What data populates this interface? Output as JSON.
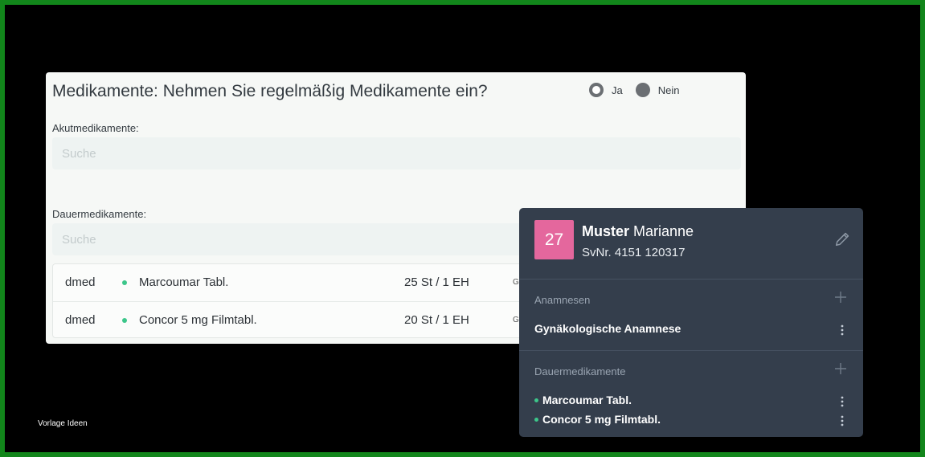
{
  "form": {
    "title": "Medikamente: Nehmen Sie regelmäßig Medikamente ein?",
    "radio": {
      "yes_label": "Ja",
      "no_label": "Nein",
      "selected": "Ja"
    },
    "akut": {
      "label": "Akutmedikamente:",
      "placeholder": "Suche",
      "value": ""
    },
    "dauer": {
      "label": "Dauermedikamente:",
      "placeholder": "Suche",
      "value": ""
    },
    "medications": [
      {
        "source": "dmed",
        "name": "Marcoumar Tabl.",
        "quantity": "25 St / 1 EH",
        "extra": "G"
      },
      {
        "source": "dmed",
        "name": "Concor 5 mg Filmtabl.",
        "quantity": "20 St / 1 EH",
        "extra": "G"
      }
    ]
  },
  "patient": {
    "age": "27",
    "last_name": "Muster",
    "first_name": "Marianne",
    "svnr_label": "SvNr.",
    "svnr": "4151  120317",
    "sections": {
      "anamnesen": {
        "title": "Anamnesen",
        "items": [
          "Gynäkologische Anamnese"
        ]
      },
      "dauermedikamente": {
        "title": "Dauermedikamente",
        "items": [
          "Marcoumar Tabl.",
          "Concor 5 mg Filmtabl."
        ]
      }
    }
  },
  "watermark": "Vorlage Ideen",
  "colors": {
    "frame_border": "#12861b",
    "age_badge": "#e4679d",
    "status_dot": "#3cc68a",
    "patient_card_bg": "#343e4c"
  },
  "icons": {
    "edit": "pencil-icon",
    "add": "plus-icon",
    "menu": "kebab-icon"
  }
}
